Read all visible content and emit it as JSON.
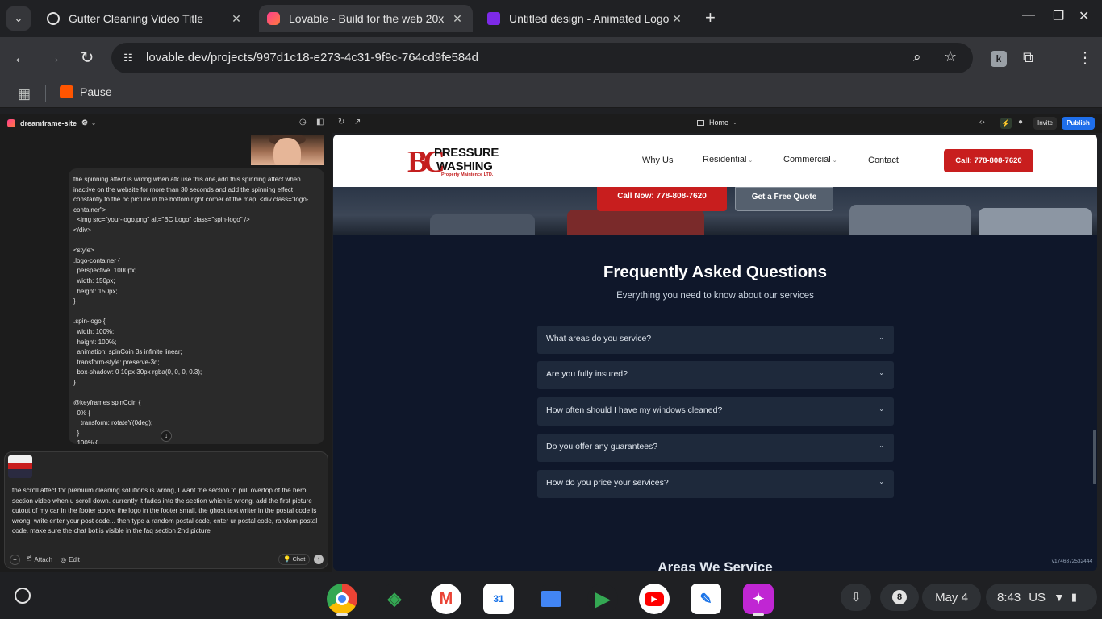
{
  "browser": {
    "tabs": [
      {
        "title": "Gutter Cleaning Video Title",
        "active": false,
        "favicon_color": "#e3e3e3"
      },
      {
        "title": "Lovable - Build for the web 20x",
        "active": true,
        "favicon_color": "#ff4d8d"
      },
      {
        "title": "Untitled design - Animated Logo",
        "active": false,
        "favicon_color": "#7d2ae8"
      }
    ],
    "url": "lovable.dev/projects/997d1c18-e273-4c31-9f9c-764cd9fe584d",
    "bookmark": "Pause",
    "extension_letter": "k"
  },
  "lovable": {
    "project_name": "dreamframe-site",
    "page_selector": "Home",
    "invite_label": "Invite",
    "publish_label": "Publish"
  },
  "chat": {
    "user_message": "the spinning affect is wrong when afk use this one,add this spinning affect when inactive on the website for more than 30 seconds and add the spinning effect constantly to the bc picture in the bottom right corner of the map  <div class=\"logo-container\">\n  <img src=\"your-logo.png\" alt=\"BC Logo\" class=\"spin-logo\" />\n</div>\n\n<style>\n.logo-container {\n  perspective: 1000px;\n  width: 150px;\n  height: 150px;\n}\n\n.spin-logo {\n  width: 100%;\n  height: 100%;\n  animation: spinCoin 3s infinite linear;\n  transform-style: preserve-3d;\n  box-shadow: 0 10px 30px rgba(0, 0, 0, 0.3);\n}\n\n@keyframes spinCoin {\n  0% {\n    transform: rotateY(0deg);\n  }\n  100% {",
    "composer_text": "the scroll affect for premium cleaning solutions is wrong, I want the section to pull overtop of the hero section video when u scroll down. currently it fades into the section which is wrong. add the first picture cutout of my car in the footer above the logo in the footer small. the ghost text writer in the postal code is wrong, write enter your post code... then type a random postal code, enter ur postal code, random postal code. make sure the chat bot is visible in the faq section 2nd picture",
    "attach_label": "Attach",
    "edit_label": "Edit",
    "chat_label": "Chat"
  },
  "site": {
    "brand": {
      "line1": "PRESSURE",
      "line2": "WASHING",
      "tagline": "Property Maintence LTD.",
      "mark": "BC"
    },
    "nav": [
      {
        "label": "Why Us",
        "dropdown": false
      },
      {
        "label": "Residential",
        "dropdown": true
      },
      {
        "label": "Commercial",
        "dropdown": true
      },
      {
        "label": "Contact",
        "dropdown": false
      }
    ],
    "nav_cta": "Call: 778-808-7620",
    "hero_call": "Call Now: 778-808-7620",
    "hero_quote": "Get a Free Quote",
    "faq_title": "Frequently Asked Questions",
    "faq_subtitle": "Everything you need to know about our services",
    "faqs": [
      "What areas do you service?",
      "Are you fully insured?",
      "How often should I have my windows cleaned?",
      "Do you offer any guarantees?",
      "How do you price your services?"
    ],
    "next_section": "Areas We Service",
    "version": "v1746372532444",
    "colors": {
      "accent": "#c81e1e",
      "background": "#0f172a",
      "card": "#1e293b"
    }
  },
  "shelf": {
    "apps": [
      {
        "name": "Chrome",
        "glyph": "",
        "color": "#1a73e8"
      },
      {
        "name": "Sheets",
        "glyph": "",
        "color": "#34a853"
      },
      {
        "name": "Gmail",
        "glyph": "M",
        "color": "#ffffff"
      },
      {
        "name": "Calendar",
        "glyph": "31",
        "color": "#ffffff"
      },
      {
        "name": "Files",
        "glyph": "",
        "color": "#4285f4"
      },
      {
        "name": "Play Store",
        "glyph": "",
        "color": "#01875f"
      },
      {
        "name": "YouTube",
        "glyph": "",
        "color": "#ff0000"
      },
      {
        "name": "Keep",
        "glyph": "",
        "color": "#ffffff"
      },
      {
        "name": "Canva",
        "glyph": "",
        "color": "#c026d3"
      }
    ],
    "notification_count": "8",
    "date": "May 4",
    "time": "8:43",
    "locale": "US"
  }
}
